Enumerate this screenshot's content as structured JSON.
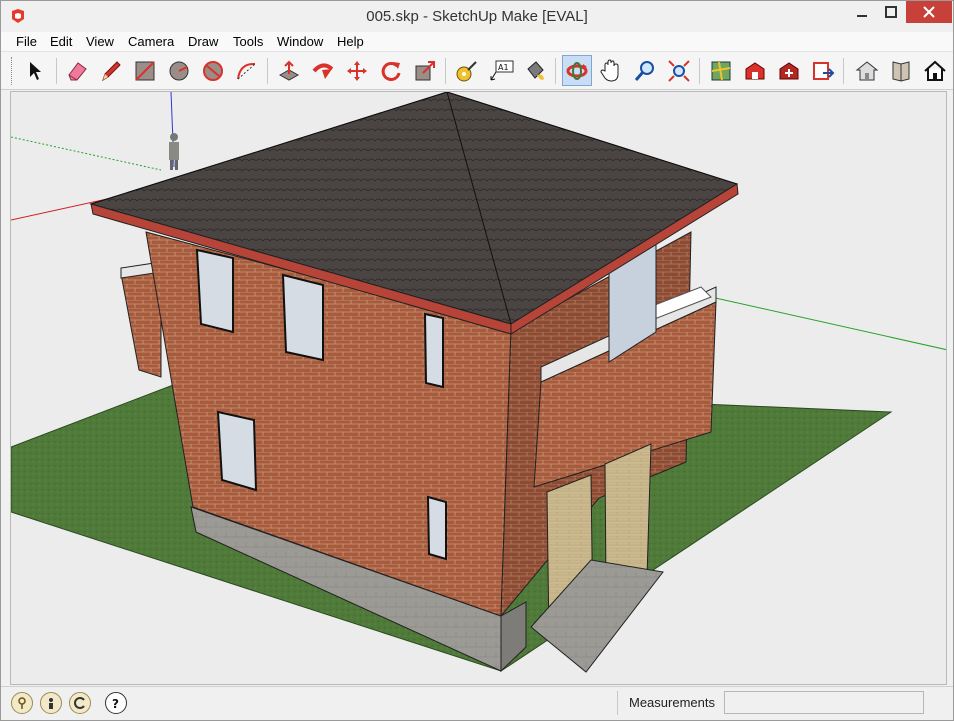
{
  "window": {
    "title": "005.skp - SketchUp Make [EVAL]"
  },
  "menubar": {
    "items": [
      {
        "label": "File",
        "icon": ""
      },
      {
        "label": "Edit"
      },
      {
        "label": "View"
      },
      {
        "label": "Camera"
      },
      {
        "label": "Draw"
      },
      {
        "label": "Tools"
      },
      {
        "label": "Window"
      },
      {
        "label": "Help"
      }
    ]
  },
  "toolbar": {
    "tools": [
      {
        "name": "select-tool",
        "icon": "arrow-cursor-icon"
      },
      {
        "name": "eraser-tool",
        "icon": "eraser-icon"
      },
      {
        "name": "line-tool",
        "icon": "pencil-icon"
      },
      {
        "name": "rectangle-tool",
        "icon": "rectangle-icon"
      },
      {
        "name": "circle-tool",
        "icon": "circle-icon"
      },
      {
        "name": "polygon-tool",
        "icon": "polygon-icon"
      },
      {
        "name": "arc-tool",
        "icon": "arc-icon"
      },
      {
        "name": "push-pull-tool",
        "icon": "push-pull-icon"
      },
      {
        "name": "follow-me-tool",
        "icon": "follow-me-icon"
      },
      {
        "name": "move-tool",
        "icon": "move-icon"
      },
      {
        "name": "rotate-tool",
        "icon": "rotate-icon"
      },
      {
        "name": "scale-tool",
        "icon": "scale-icon"
      },
      {
        "name": "tape-measure-tool",
        "icon": "tape-measure-icon"
      },
      {
        "name": "text-tool",
        "icon": "text-icon"
      },
      {
        "name": "paint-bucket-tool",
        "icon": "paint-bucket-icon"
      },
      {
        "name": "orbit-tool",
        "icon": "orbit-icon"
      },
      {
        "name": "pan-tool",
        "icon": "hand-icon"
      },
      {
        "name": "zoom-tool",
        "icon": "magnifier-icon"
      },
      {
        "name": "zoom-extents-tool",
        "icon": "zoom-extents-icon"
      },
      {
        "name": "add-location-tool",
        "icon": "map-icon"
      },
      {
        "name": "3d-warehouse-tool",
        "icon": "warehouse-icon"
      },
      {
        "name": "extension-warehouse-tool",
        "icon": "extension-icon"
      },
      {
        "name": "share-model-tool",
        "icon": "share-icon"
      },
      {
        "name": "component-tool",
        "icon": "house-component-icon"
      },
      {
        "name": "layout-tool",
        "icon": "book-icon"
      },
      {
        "name": "home-tool",
        "icon": "home-icon"
      }
    ],
    "text_tool_label": "A1",
    "active_tool": "orbit-tool"
  },
  "statusbar": {
    "measurements_label": "Measurements",
    "measurements_value": ""
  },
  "colors": {
    "brick": "#a85a3c",
    "roof": "#4a4542",
    "grass": "#4f7a3a",
    "close_button": "#c7403a",
    "active_tool_bg": "#c9def5"
  }
}
